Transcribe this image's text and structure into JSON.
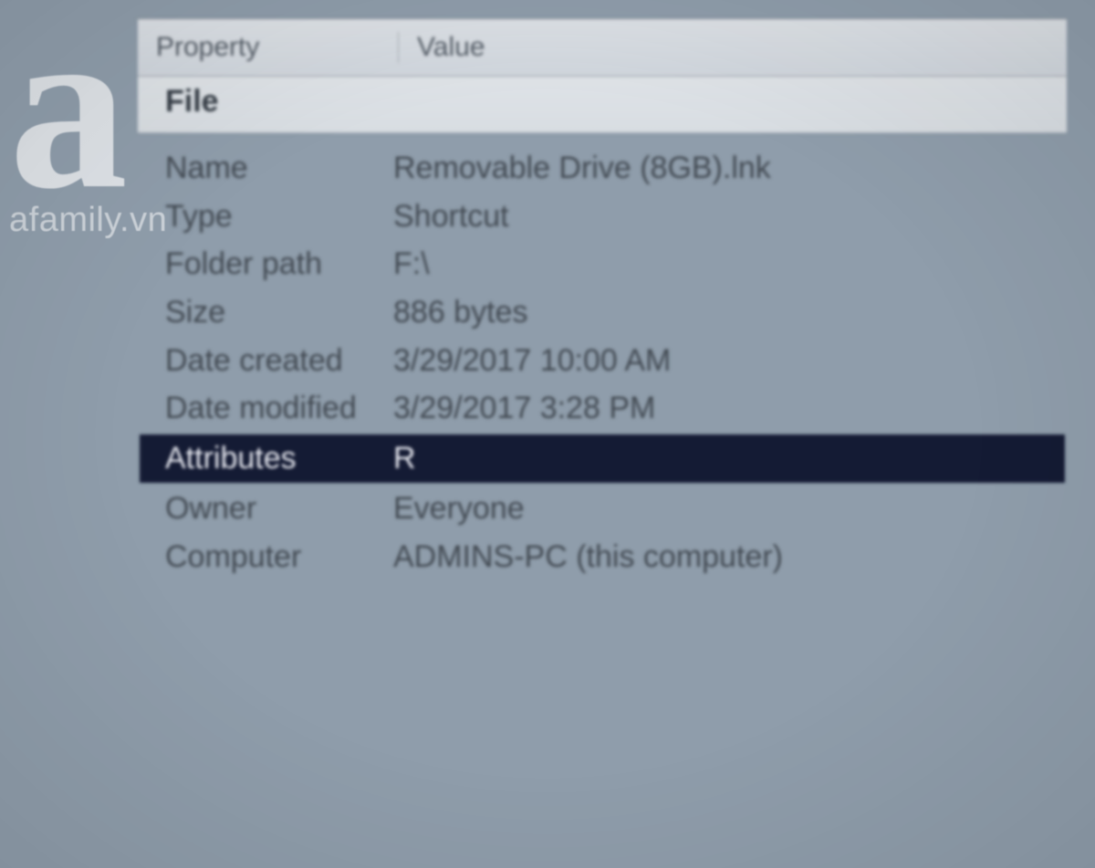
{
  "header": {
    "property_col": "Property",
    "value_col": "Value"
  },
  "group": {
    "title": "File"
  },
  "rows": [
    {
      "label": "Name",
      "value": "Removable Drive (8GB).lnk",
      "selected": false
    },
    {
      "label": "Type",
      "value": "Shortcut",
      "selected": false
    },
    {
      "label": "Folder path",
      "value": "F:\\",
      "selected": false
    },
    {
      "label": "Size",
      "value": "886 bytes",
      "selected": false
    },
    {
      "label": "Date created",
      "value": "3/29/2017 10:00 AM",
      "selected": false
    },
    {
      "label": "Date modified",
      "value": "3/29/2017 3:28 PM",
      "selected": false
    },
    {
      "label": "Attributes",
      "value": "R",
      "selected": true
    },
    {
      "label": "Owner",
      "value": "Everyone",
      "selected": false
    },
    {
      "label": "Computer",
      "value": "ADMINS-PC (this computer)",
      "selected": false
    }
  ],
  "watermark": {
    "logo_letter": "a",
    "text": "afamily.vn"
  }
}
